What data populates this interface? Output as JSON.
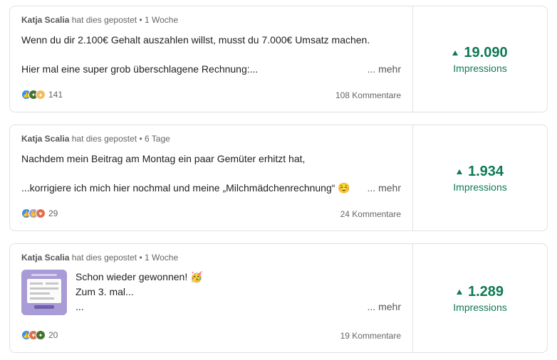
{
  "posts": [
    {
      "author": "Katja Scalia",
      "action": "hat dies gepostet",
      "time": "1 Woche",
      "lines": [
        "Wenn du dir 2.100€ Gehalt auszahlen willst, musst du 7.000€ Umsatz machen.",
        "Hier mal eine super grob überschlagene Rechnung:..."
      ],
      "more": "... mehr",
      "reaction_icons": [
        "like-icon",
        "celebrate-icon",
        "insightful-icon"
      ],
      "reaction_count": "141",
      "comments": "108 Kommentare",
      "impressions": "19.090",
      "impressions_label": "Impressions"
    },
    {
      "author": "Katja Scalia",
      "action": "hat dies gepostet",
      "time": "6 Tage",
      "lines": [
        "Nachdem mein Beitrag am Montag ein paar Gemüter erhitzt hat,",
        "...korrigiere ich mich hier nochmal und meine „Milchmädchenrechnung“ ☺️"
      ],
      "more": "... mehr",
      "reaction_icons": [
        "like-icon",
        "support-icon",
        "love-icon"
      ],
      "reaction_count": "29",
      "comments": "24 Kommentare",
      "impressions": "1.934",
      "impressions_label": "Impressions"
    },
    {
      "author": "Katja Scalia",
      "action": "hat dies gepostet",
      "time": "1 Woche",
      "lines": [
        "Schon wieder gewonnen! 🥳",
        "Zum 3. mal...",
        "..."
      ],
      "more": "... mehr",
      "reaction_icons": [
        "like-icon",
        "love-icon",
        "celebrate-icon"
      ],
      "reaction_count": "20",
      "comments": "19 Kommentare",
      "impressions": "1.289",
      "impressions_label": "Impressions"
    }
  ],
  "colors": {
    "accent_green": "#0d7a52",
    "like_blue": "#378fe9",
    "celebrate_green": "#44712e",
    "insightful_yellow": "#f5bb5c",
    "love_red": "#df704d",
    "support_purple": "#a59ed3"
  }
}
